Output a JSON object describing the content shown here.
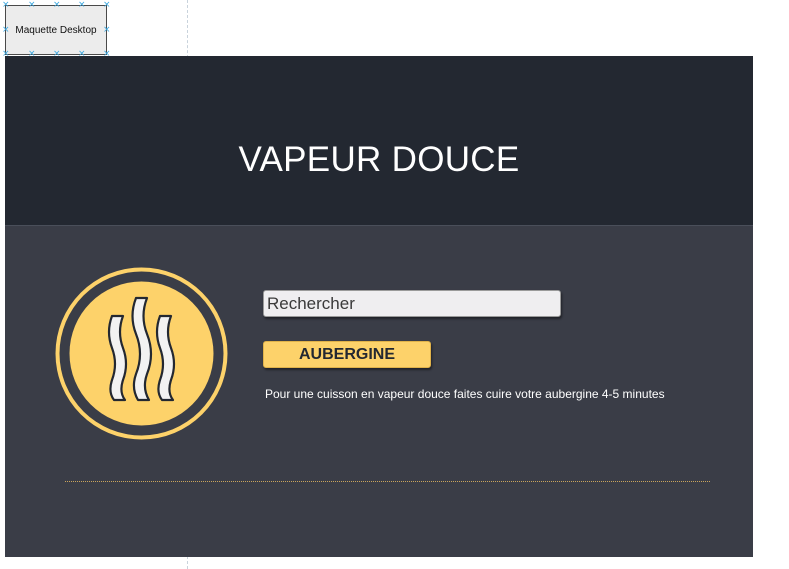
{
  "artboard": {
    "label": "Maquette Desktop"
  },
  "header": {
    "title": "VAPEUR DOUCE"
  },
  "search": {
    "placeholder": "Rechercher"
  },
  "cta": {
    "label": "AUBERGINE"
  },
  "description": "Pour une cuisson en vapeur douce faites cuire votre aubergine 4-5 minutes",
  "logo": {
    "icon": "steam-icon"
  },
  "colors": {
    "header_bg": "#232831",
    "body_bg": "#3a3d47",
    "accent": "#fdd26a",
    "text": "#ffffff"
  }
}
